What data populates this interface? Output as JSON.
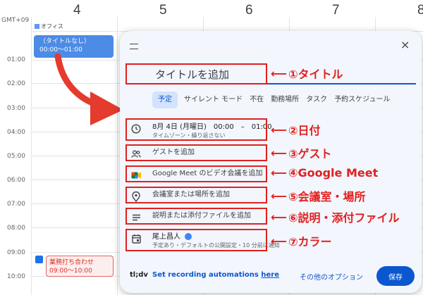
{
  "calendar": {
    "gmt": "GMT+09",
    "days": [
      "4",
      "5",
      "6",
      "7",
      "8"
    ],
    "allday_event": "オフィス",
    "hours": [
      "01:00",
      "02:00",
      "03:00",
      "04:00",
      "05:00",
      "06:00",
      "07:00",
      "08:00",
      "09:00",
      "10:00"
    ],
    "event_blue": {
      "title": "（タイトルなし）",
      "time": "00:00～01:00"
    },
    "event_pink": {
      "title": "業務打ち合わせ",
      "time": "09:00～10:00"
    }
  },
  "dialog": {
    "close": "×",
    "title_placeholder": "タイトルを追加",
    "tabs": [
      "予定",
      "サイレント モード",
      "不在",
      "勤務場所",
      "タスク",
      "予約スケジュール"
    ],
    "date": {
      "main": "8月 4日 (月曜日)　00:00　–　01:00",
      "sub": "タイムゾーン・繰り返さない"
    },
    "guests": "ゲストを追加",
    "meet": "Google Meet のビデオ会議を追加",
    "location": "会議室または場所を追加",
    "description": "説明または添付ファイルを追加",
    "calendar": {
      "owner": "尾上昌人",
      "sub": "予定あり・デフォルトの公開設定・10 分前に通知"
    },
    "footer": {
      "logo": "tl;dv",
      "recording_prefix": "Set recording automations ",
      "recording_link": "here",
      "more_options": "その他のオプション",
      "save": "保存"
    }
  },
  "annotations": {
    "arrow": "⟵",
    "items": [
      "①タイトル",
      "②日付",
      "③ゲスト",
      "④Google Meet",
      "⑤会議室・場所",
      "⑥説明・添付ファイル",
      "⑦カラー"
    ]
  },
  "colors": {
    "accent": "#0b57d0",
    "annotation": "#e02020",
    "event": "#4c8be6"
  }
}
